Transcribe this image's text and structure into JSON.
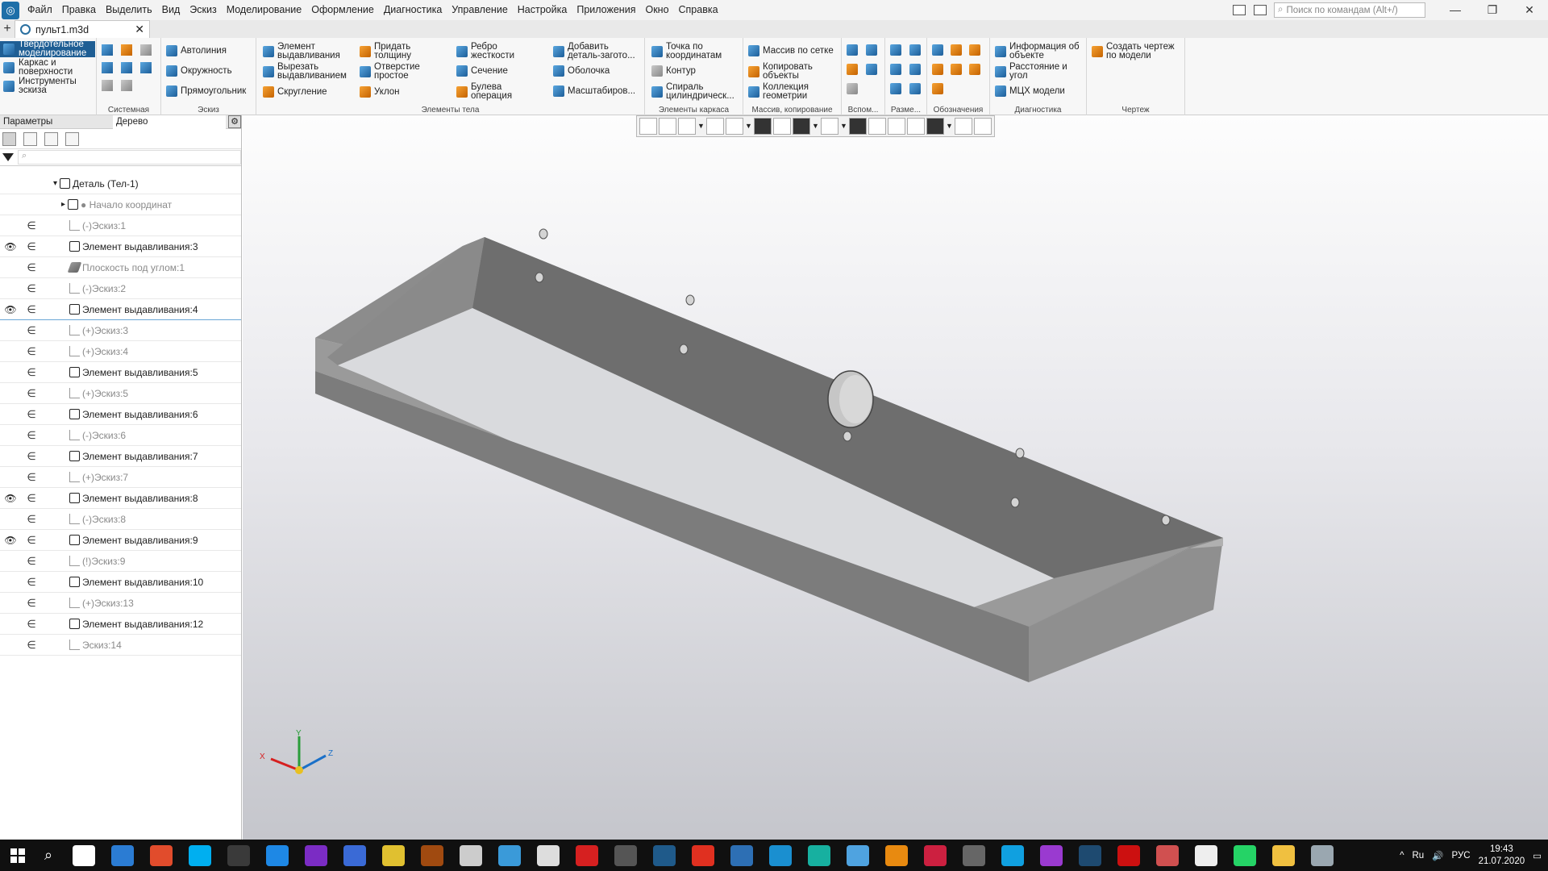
{
  "menubar": {
    "items": [
      "Файл",
      "Правка",
      "Выделить",
      "Вид",
      "Эскиз",
      "Моделирование",
      "Оформление",
      "Диагностика",
      "Управление",
      "Настройка",
      "Приложения",
      "Окно",
      "Справка"
    ],
    "search_placeholder": "Поиск по командам (Alt+/)",
    "win_min": "—",
    "win_max": "❐",
    "win_close": "✕"
  },
  "tabs": {
    "add": "+",
    "doc_title": "пульт1.m3d",
    "close": "✕"
  },
  "ribbon": {
    "modes": [
      "Твердотельное\nмоделирование",
      "Каркас и\nповерхности",
      "Инструменты\nэскиза"
    ],
    "groups": {
      "system": {
        "label": "Системная"
      },
      "sketch": {
        "label": "Эскиз",
        "buttons": [
          "Автолиния",
          "Окружность",
          "Прямоугольник"
        ]
      },
      "body": {
        "label": "Элементы тела",
        "buttons": [
          "Элемент\nвыдавливания",
          "Вырезать\nвыдавливанием",
          "Скругление",
          "Придать\nтолщину",
          "Отверстие\nпростое",
          "Уклон",
          "Ребро\nжесткости",
          "Сечение",
          "Булева\nоперация",
          "Добавить\nдеталь-загото...",
          "Оболочка",
          "Масштабиров..."
        ]
      },
      "frame": {
        "label": "Элементы каркаса",
        "buttons": [
          "Точка по\nкоординатам",
          "Контур",
          "Спираль\nцилиндрическ..."
        ]
      },
      "array": {
        "label": "Массив, копирование",
        "buttons": [
          "Массив по сетке",
          "Копировать\nобъекты",
          "Коллекция\nгеометрии"
        ]
      },
      "aux": {
        "label": "Вспом..."
      },
      "dims": {
        "label": "Разме..."
      },
      "marks": {
        "label": "Обозначения"
      },
      "diag": {
        "label": "Диагностика",
        "buttons": [
          "Информация об\nобъекте",
          "Расстояние и\nугол",
          "МЦХ модели"
        ]
      },
      "drawing": {
        "label": "Чертеж",
        "buttons": [
          "Создать чертеж\nпо модели"
        ]
      }
    }
  },
  "panel": {
    "tab_params": "Параметры",
    "tab_tree": "Дерево",
    "filter_placeholder": "⌕",
    "tree": [
      {
        "label": "Деталь (Тел-1)",
        "indent": 0,
        "eye": "",
        "vis": "",
        "icon": "root",
        "grey": false
      },
      {
        "label": "● Начало координат",
        "indent": 1,
        "eye": "",
        "vis": "",
        "icon": "axis",
        "grey": true
      },
      {
        "label": "(-)Эскиз:1",
        "indent": 2,
        "eye": "",
        "vis": "∈",
        "icon": "sketch",
        "grey": true
      },
      {
        "label": "Элемент выдавливания:3",
        "indent": 2,
        "eye": "👁",
        "vis": "∈",
        "icon": "extrude",
        "grey": false
      },
      {
        "label": "Плоскость под углом:1",
        "indent": 2,
        "eye": "",
        "vis": "∈",
        "icon": "plane",
        "grey": true
      },
      {
        "label": "(-)Эскиз:2",
        "indent": 2,
        "eye": "",
        "vis": "∈",
        "icon": "sketch",
        "grey": true
      },
      {
        "label": "Элемент выдавливания:4",
        "indent": 2,
        "eye": "👁",
        "vis": "∈",
        "icon": "extrude",
        "grey": false,
        "selected": true
      },
      {
        "label": "(+)Эскиз:3",
        "indent": 2,
        "eye": "",
        "vis": "∈",
        "icon": "sketch",
        "grey": true
      },
      {
        "label": "(+)Эскиз:4",
        "indent": 2,
        "eye": "",
        "vis": "∈",
        "icon": "sketch",
        "grey": true
      },
      {
        "label": "Элемент выдавливания:5",
        "indent": 2,
        "eye": "",
        "vis": "∈",
        "icon": "cut",
        "grey": false
      },
      {
        "label": "(+)Эскиз:5",
        "indent": 2,
        "eye": "",
        "vis": "∈",
        "icon": "sketch",
        "grey": true
      },
      {
        "label": "Элемент выдавливания:6",
        "indent": 2,
        "eye": "",
        "vis": "∈",
        "icon": "cut",
        "grey": false
      },
      {
        "label": "(-)Эскиз:6",
        "indent": 2,
        "eye": "",
        "vis": "∈",
        "icon": "sketch",
        "grey": true
      },
      {
        "label": "Элемент выдавливания:7",
        "indent": 2,
        "eye": "",
        "vis": "∈",
        "icon": "cut",
        "grey": false
      },
      {
        "label": "(+)Эскиз:7",
        "indent": 2,
        "eye": "",
        "vis": "∈",
        "icon": "sketch",
        "grey": true
      },
      {
        "label": "Элемент выдавливания:8",
        "indent": 2,
        "eye": "👁",
        "vis": "∈",
        "icon": "extrude",
        "grey": false
      },
      {
        "label": "(-)Эскиз:8",
        "indent": 2,
        "eye": "",
        "vis": "∈",
        "icon": "sketch",
        "grey": true
      },
      {
        "label": "Элемент выдавливания:9",
        "indent": 2,
        "eye": "👁",
        "vis": "∈",
        "icon": "extrude",
        "grey": false
      },
      {
        "label": "(!)Эскиз:9",
        "indent": 2,
        "eye": "",
        "vis": "∈",
        "icon": "sketch",
        "grey": true
      },
      {
        "label": "Элемент выдавливания:10",
        "indent": 2,
        "eye": "",
        "vis": "∈",
        "icon": "cut",
        "grey": false
      },
      {
        "label": "(+)Эскиз:13",
        "indent": 2,
        "eye": "",
        "vis": "∈",
        "icon": "sketch",
        "grey": true
      },
      {
        "label": "Элемент выдавливания:12",
        "indent": 2,
        "eye": "",
        "vis": "∈",
        "icon": "cut",
        "grey": false
      },
      {
        "label": "Эскиз:14",
        "indent": 2,
        "eye": "",
        "vis": "∈",
        "icon": "sketch",
        "grey": true
      }
    ]
  },
  "axes": {
    "x": "X",
    "y": "Y",
    "z": "Z"
  },
  "taskbar": {
    "icon_colors": [
      "#ffffff",
      "#2b7cd3",
      "#e14c2c",
      "#00aff0",
      "#3a3a3a",
      "#1e88e5",
      "#7b2cc4",
      "#3a6ad6",
      "#e0c030",
      "#a04a10",
      "#cccccc",
      "#3a9ad9",
      "#dddddd",
      "#d62020",
      "#555555",
      "#1f5a8a",
      "#e03020",
      "#2d6fb4",
      "#1a8fd0",
      "#17b0a0",
      "#4fa3e0",
      "#e88a10",
      "#cc2040",
      "#666666",
      "#10a0e0",
      "#9a3ad0",
      "#1e4a70",
      "#cc1010",
      "#d05050",
      "#eeeeee",
      "#25d366",
      "#f0c040",
      "#9aa7b0"
    ],
    "lang": "РУС",
    "time": "19:43",
    "date": "21.07.2020",
    "tray_text": "Ru"
  }
}
